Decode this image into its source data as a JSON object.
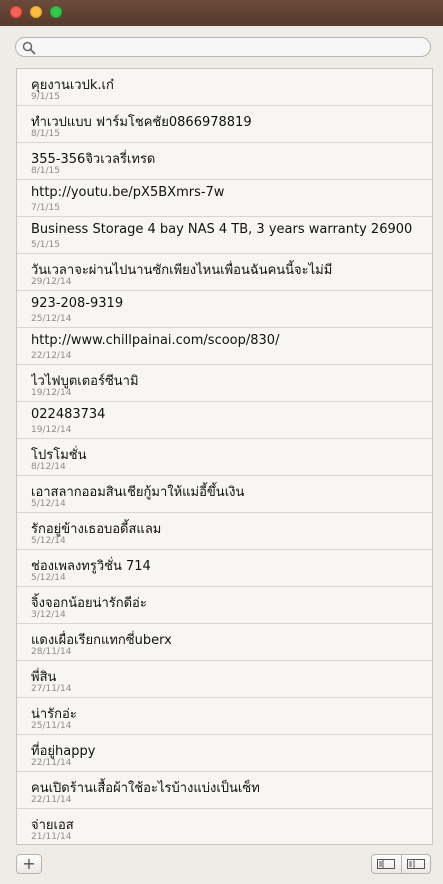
{
  "search": {
    "placeholder": "",
    "value": ""
  },
  "notes": [
    {
      "title": "คุยงานเวปk.เก๋",
      "date": "9/1/15"
    },
    {
      "title": "ทำเวปแบบ ฟาร์มโชคชัย0866978819",
      "date": "8/1/15"
    },
    {
      "title": "355-356จิวเวลรี่เทรด",
      "date": "8/1/15"
    },
    {
      "title": "http://youtu.be/pX5BXmrs-7w",
      "date": "7/1/15"
    },
    {
      "title": "Business Storage 4 bay NAS 4 TB, 3 years warranty 26900",
      "date": "5/1/15"
    },
    {
      "title": "วันเวลาจะผ่านไปนานซักเพียงไหนเพื่อนฉันคนนี้จะไม่มี",
      "date": "29/12/14"
    },
    {
      "title": "923-208-9319",
      "date": "25/12/14"
    },
    {
      "title": "http://www.chillpainai.com/scoop/830/",
      "date": "22/12/14"
    },
    {
      "title": "ไวไฟบูตเตอร์ซีนามิ",
      "date": "19/12/14"
    },
    {
      "title": "022483734",
      "date": "19/12/14"
    },
    {
      "title": "โปรโมชั่น",
      "date": "8/12/14"
    },
    {
      "title": "เอาสลากออมสินเชียกู้มาให้แม่อี้ขึ้นเงิน",
      "date": "5/12/14"
    },
    {
      "title": "รักอยู่ข้างเธอบอดี้สแลม",
      "date": "5/12/14"
    },
    {
      "title": "ช่องเพลงทรูวิชั่น 714",
      "date": "5/12/14"
    },
    {
      "title": "จิ้งจอกน้อยน่ารักดีอ่ะ",
      "date": "3/12/14"
    },
    {
      "title": "แดงเผื่อเรียกแทกซี่uberx",
      "date": "28/11/14"
    },
    {
      "title": "พี่สิน",
      "date": "27/11/14"
    },
    {
      "title": "น่ารักอ่ะ",
      "date": "25/11/14"
    },
    {
      "title": "ที่อยู่happy",
      "date": "22/11/14"
    },
    {
      "title": "คนเปิดร้านเสื้อผ้าใช้อะไรบ้างแบ่งเป็นเซ็ท",
      "date": "22/11/14"
    },
    {
      "title": "จ่ายเอส",
      "date": "21/11/14"
    }
  ],
  "toolbar": {
    "add_label": "+"
  }
}
